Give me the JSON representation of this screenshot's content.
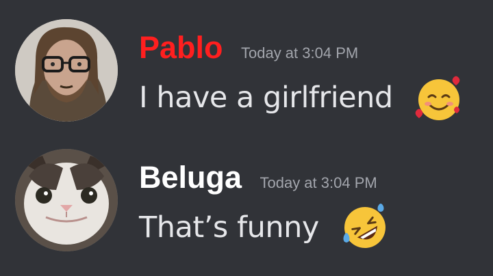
{
  "messages": [
    {
      "username": "Pablo",
      "username_color": "#ff1f1f",
      "timestamp": "Today at 3:04 PM",
      "text": "I have a girlfriend",
      "emoji": "smiling-face-with-hearts-icon",
      "avatar": "man-with-glasses-avatar"
    },
    {
      "username": "Beluga",
      "username_color": "#ffffff",
      "timestamp": "Today at 3:04 PM",
      "text": "That’s funny",
      "emoji": "rolling-on-floor-laughing-icon",
      "avatar": "cat-avatar"
    }
  ],
  "colors": {
    "background": "#313338",
    "timestamp": "#a3a6ad",
    "message_text": "#e6e7ea"
  }
}
